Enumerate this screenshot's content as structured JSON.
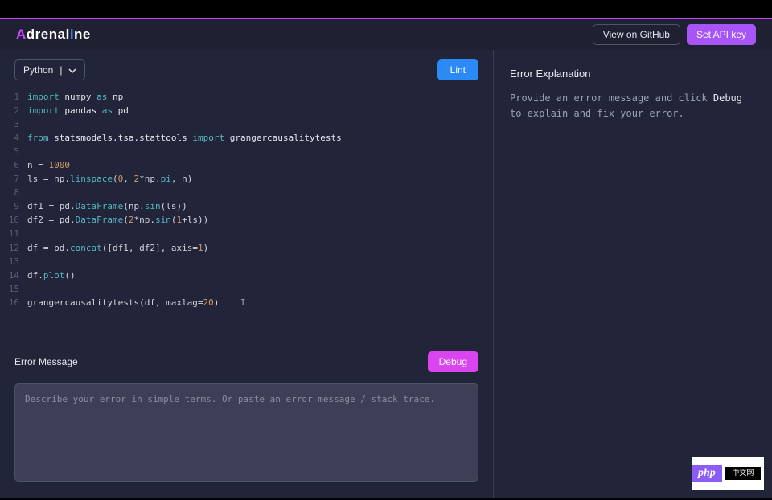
{
  "app": {
    "name": "Adrenaline"
  },
  "header": {
    "github": "View on GitHub",
    "apikey": "Set API key"
  },
  "editor": {
    "language": "Python",
    "lint": "Lint",
    "lines": 16
  },
  "error_panel": {
    "title": "Error Message",
    "debug": "Debug",
    "placeholder": "Describe your error in simple terms. Or paste an error message / stack trace."
  },
  "explanation": {
    "title": "Error Explanation",
    "text_pre": "Provide an error message and click ",
    "text_hl": "Debug",
    "text_post": " to explain and fix your error."
  },
  "code": {
    "l1": {
      "kw": "import",
      "mod": "numpy",
      "as": "as",
      "alias": "np"
    },
    "l2": {
      "kw": "import",
      "mod": "pandas",
      "as": "as",
      "alias": "pd"
    },
    "l4a": "from",
    "l4b": "statsmodels.tsa.stattools",
    "l4c": "import",
    "l4d": "grangercausalitytests",
    "l6": "n = ",
    "l6n": "1000",
    "l7": "ls = np.",
    "l7fn": "linspace",
    "l7a": "(",
    "l7n1": "0",
    "l7c": ", ",
    "l7n2": "2",
    "l7m": "*np.",
    "l7pi": "pi",
    "l7e": ", n)",
    "l9": "df1 = pd.",
    "l9fn": "DataFrame",
    "l9a": "(np.",
    "l9sin": "sin",
    "l9e": "(ls))",
    "l10": "df2 = pd.",
    "l10fn": "DataFrame",
    "l10a": "(",
    "l10n": "2",
    "l10m": "*np.",
    "l10sin": "sin",
    "l10p": "(",
    "l10n2": "1",
    "l10plus": "+",
    "l10e": "ls))",
    "l12": "df = pd.",
    "l12fn": "concat",
    "l12a": "([df1, df2], axis=",
    "l12n": "1",
    "l12e": ")",
    "l14": "df.",
    "l14fn": "plot",
    "l14e": "()",
    "l16": "grangercausalitytests(df, maxlag=",
    "l16n": "20",
    "l16e": ")"
  },
  "badge": {
    "php": "php",
    "cn": "中文网"
  }
}
